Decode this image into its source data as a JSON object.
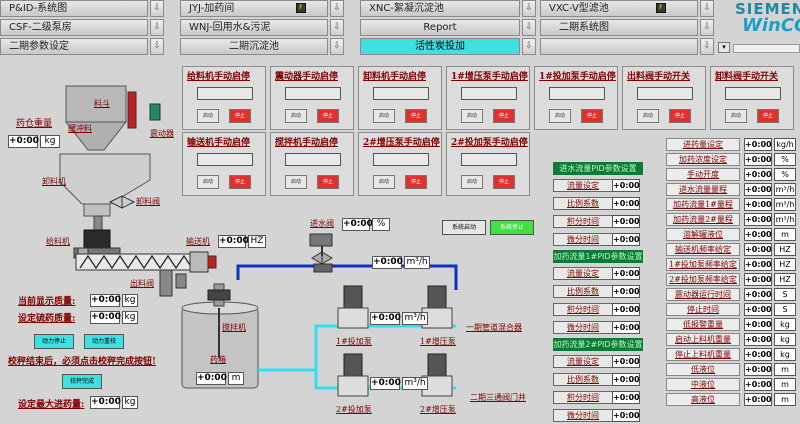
{
  "nav": {
    "row1": [
      {
        "label": "P&ID-系统图",
        "icon": "placeholder"
      },
      {
        "label": "JYJ-加药间",
        "icon": "flag"
      },
      {
        "label": "XNC-絮凝沉淀池",
        "icon": "placeholder"
      },
      {
        "label": "VXC-V型滤池",
        "icon": "flag"
      }
    ],
    "row2": [
      {
        "label": "CSF-二级泵房"
      },
      {
        "label": "WNJ-回用水&污泥"
      },
      {
        "label": "Report"
      },
      {
        "label": "二期系统图"
      }
    ],
    "row3": [
      {
        "label": "二期参数设定"
      },
      {
        "label": "二期沉淀池"
      },
      {
        "label": "活性炭投加",
        "active": true
      },
      {
        "label": ""
      }
    ],
    "arrow": "⇩"
  },
  "brand": {
    "line1": "SIEMENS",
    "line2": "WinCC"
  },
  "left": {
    "hopper_label": "料斗",
    "buffer_label": "缓冲料",
    "vibrator_label": "震动器",
    "unloader_label": "卸料机",
    "unload_valve_label": "卸料阀",
    "feeder_label": "给料机",
    "conveyor_label": "输送机",
    "discharge_valve_label": "出料阀",
    "tank_label": "药箱",
    "mixer_label": "搅拌机",
    "silo_weight_label": "药仓重量",
    "silo_weight_value": "+0:00",
    "silo_weight_unit": "kg",
    "conveyor_value": "+0:00",
    "conveyor_unit": "HZ",
    "current_weight_label": "当前显示质量:",
    "current_weight_value": "+0:00",
    "current_weight_unit": "kg",
    "set_weight_label": "设定硫药质量:",
    "set_weight_value": "+0:00",
    "set_weight_unit": "kg",
    "btn_auto_stop": "动力停止",
    "btn_auto_clear": "动力重校",
    "warning": "校秤结束后，必须点击校秤完成按钮!",
    "btn_calib_done": "校秤完成",
    "max_weight_label": "设定最大进药量:",
    "max_weight_value": "+0:00",
    "max_weight_unit": "kg",
    "tank_value": "+0:00",
    "tank_unit": "m"
  },
  "panels": [
    {
      "title": "给料机手动启停",
      "start": "启动",
      "stop": "停止"
    },
    {
      "title": "震动器手动启停",
      "start": "启动",
      "stop": "停止"
    },
    {
      "title": "卸料机手动启停",
      "start": "启动",
      "stop": "停止"
    },
    {
      "title": "1#增压泵手动启停",
      "start": "启动",
      "stop": "停止"
    },
    {
      "title": "1#投加泵手动启停",
      "start": "启动",
      "stop": "停止"
    },
    {
      "title": "出料阀手动开关",
      "start": "启动",
      "stop": "停止"
    },
    {
      "title": "卸料阀手动开关",
      "start": "启动",
      "stop": "停止"
    },
    {
      "title": "输送机手动启停",
      "start": "启动",
      "stop": "停止"
    },
    {
      "title": "搅拌机手动启停",
      "start": "启动",
      "stop": "停止"
    },
    {
      "title": "2#增压泵手动启停",
      "start": "启动",
      "stop": "停止"
    },
    {
      "title": "2#投加泵手动启停",
      "start": "启动",
      "stop": "停止"
    }
  ],
  "process": {
    "inlet_valve_label": "进水阀",
    "inlet_valve_value": "+0:00",
    "inlet_valve_unit": "%",
    "inlet_flow_value": "+0:00",
    "inlet_flow_unit": "m³/h",
    "sys_start": "系统启动",
    "sys_stop": "系统停止",
    "pump1_flow_value": "+0:00",
    "pump1_flow_unit": "m³/h",
    "pump2_flow_value": "+0:00",
    "pump2_flow_unit": "m³/h",
    "dose_pump1": "1#投加泵",
    "boost_pump1": "1#增压泵",
    "dose_pump2": "2#投加泵",
    "boost_pump2": "2#增压泵",
    "mixer_pipe": "一期管道混合器",
    "three_way": "二期三通阀门井"
  },
  "pid": [
    {
      "title": "进水流量PID参数设置",
      "rows": [
        {
          "label": "流量设定",
          "value": "+0:00"
        },
        {
          "label": "比例系数",
          "value": "+0:00"
        },
        {
          "label": "积分时间",
          "value": "+0:00"
        },
        {
          "label": "微分时间",
          "value": "+0:00"
        }
      ]
    },
    {
      "title": "加药流量1#PID参数设置",
      "rows": [
        {
          "label": "流量设定",
          "value": "+0:00"
        },
        {
          "label": "比例系数",
          "value": "+0:00"
        },
        {
          "label": "积分时间",
          "value": "+0:00"
        },
        {
          "label": "微分时间",
          "value": "+0:00"
        }
      ]
    },
    {
      "title": "加药流量2#PID参数设置",
      "rows": [
        {
          "label": "流量设定",
          "value": "+0:00"
        },
        {
          "label": "比例系数",
          "value": "+0:00"
        },
        {
          "label": "积分时间",
          "value": "+0:00"
        },
        {
          "label": "微分时间",
          "value": "+0:00"
        }
      ]
    }
  ],
  "params": [
    {
      "label": "进药量设定",
      "value": "+0:00",
      "unit": "kg/h"
    },
    {
      "label": "加药浓度设定",
      "value": "+0:00",
      "unit": "%"
    },
    {
      "label": "手动开度",
      "value": "+0:00",
      "unit": "%"
    },
    {
      "label": "进水流量量程",
      "value": "+0:00",
      "unit": "m³/h"
    },
    {
      "label": "加药流量1#量程",
      "value": "+0:00",
      "unit": "m³/h"
    },
    {
      "label": "加药流量2#量程",
      "value": "+0:00",
      "unit": "m³/h"
    },
    {
      "label": "溶解罐液位",
      "value": "+0:00",
      "unit": "m"
    },
    {
      "label": "输送机频率给定",
      "value": "+0:00",
      "unit": "HZ"
    },
    {
      "label": "1#投加泵频率给定",
      "value": "+0:00",
      "unit": "HZ"
    },
    {
      "label": "2#投加泵频率给定",
      "value": "+0:00",
      "unit": "HZ"
    },
    {
      "label": "震动器运行时间",
      "value": "+0:00",
      "unit": "S"
    },
    {
      "label": "停止时间",
      "value": "+0:00",
      "unit": "S"
    },
    {
      "label": "低报警重量",
      "value": "+0:00",
      "unit": "kg"
    },
    {
      "label": "启动上料机重量",
      "value": "+0:00",
      "unit": "kg"
    },
    {
      "label": "停止上料机重量",
      "value": "+0:00",
      "unit": "kg"
    },
    {
      "label": "低液位",
      "value": "+0:00",
      "unit": "m"
    },
    {
      "label": "中液位",
      "value": "+0:00",
      "unit": "m"
    },
    {
      "label": "高液位",
      "value": "+0:00",
      "unit": "m"
    }
  ],
  "colors": {
    "pipe_blue": "#1030c0",
    "pipe_cyan": "#30e0f0",
    "accent_cyan": "#3fe0e0",
    "pid_green": "#0e7a3a"
  }
}
